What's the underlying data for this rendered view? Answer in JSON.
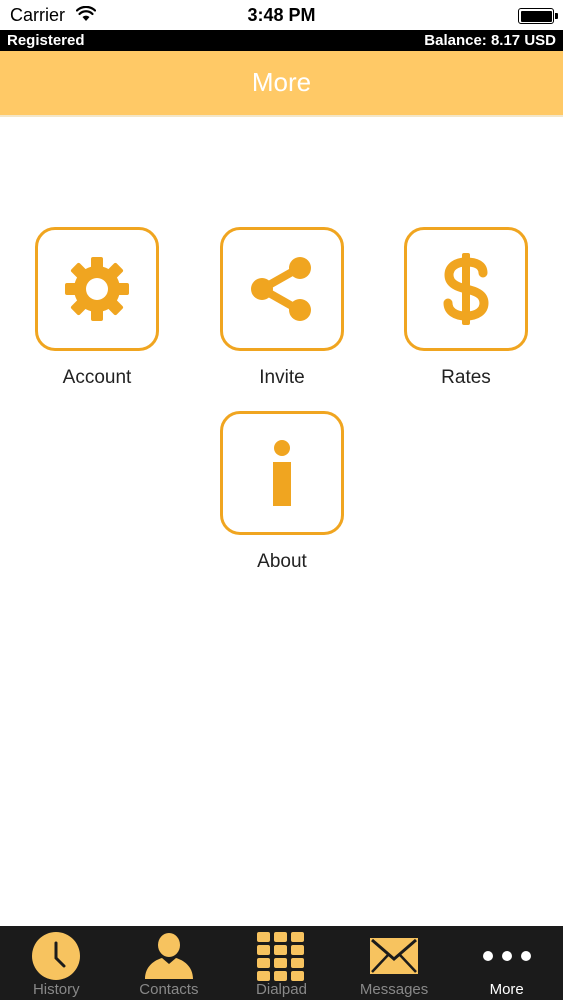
{
  "status_bar": {
    "carrier": "Carrier",
    "time": "3:48 PM"
  },
  "account_bar": {
    "status": "Registered",
    "balance": "Balance: 8.17 USD"
  },
  "header": {
    "title": "More"
  },
  "menu": {
    "items": [
      {
        "label": "Account",
        "icon": "gear-icon"
      },
      {
        "label": "Invite",
        "icon": "share-icon"
      },
      {
        "label": "Rates",
        "icon": "dollar-icon"
      },
      {
        "label": "About",
        "icon": "info-icon"
      }
    ]
  },
  "tabs": [
    {
      "label": "History",
      "icon": "clock-icon"
    },
    {
      "label": "Contacts",
      "icon": "person-icon"
    },
    {
      "label": "Dialpad",
      "icon": "dialpad-icon"
    },
    {
      "label": "Messages",
      "icon": "envelope-icon"
    },
    {
      "label": "More",
      "icon": "more-dots-icon",
      "active": true
    }
  ],
  "colors": {
    "accent": "#f0a520",
    "header_bg": "#ffc966",
    "tab_bar_bg": "#1b1b1b",
    "tab_icon": "#f7c35f"
  }
}
